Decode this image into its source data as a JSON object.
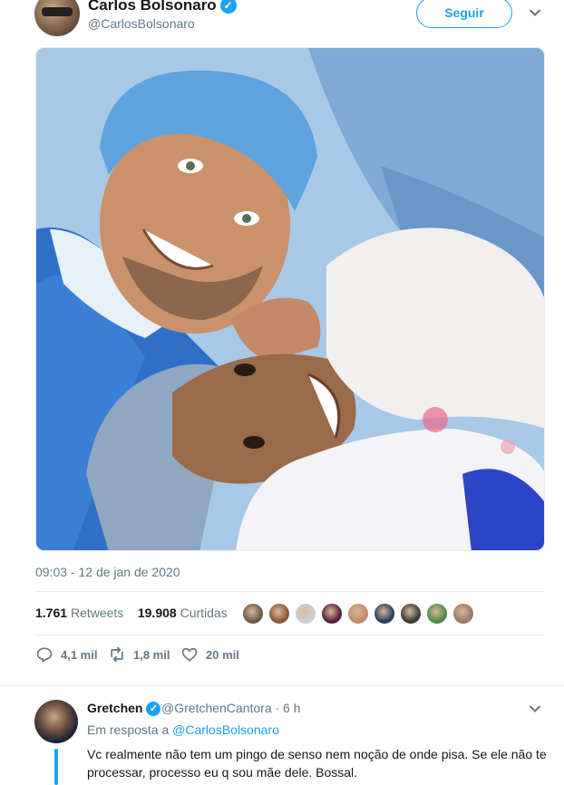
{
  "tweet": {
    "author_name": "Carlos Bolsonaro",
    "author_handle": "@CarlosBolsonaro",
    "follow_label": "Seguir",
    "timestamp": "09:03 - 12 de jan de 2020",
    "photo_icon": "photo-image",
    "stats": {
      "retweets_count": "1.761",
      "retweets_label": "Retweets",
      "likes_count": "19.908",
      "likes_label": "Curtidas"
    },
    "liker_colors": [
      "#6b5a4a",
      "#8a5a3a",
      "#cfcfcf",
      "#5a1e3a",
      "#c08a6a",
      "#2c3e5a",
      "#3a3a3a",
      "#4e8a4e",
      "#9a7a6a"
    ],
    "actions": {
      "replies": "4,1 mil",
      "retweets": "1,8 mil",
      "likes": "20 mil"
    }
  },
  "reply": {
    "author_name": "Gretchen",
    "author_handle": "@GretchenCantora · 6 h",
    "reply_prefix": "Em resposta a",
    "reply_to": "@CarlosBolsonaro",
    "text": "Vc realmente não tem um pingo de senso nem noção de onde pisa. Se ele não te processar, processo eu q sou mãe dele. Bossal."
  },
  "colors": {
    "accent": "#1da1f2",
    "secondary_text": "#657786",
    "divider": "#e6ecf0"
  }
}
